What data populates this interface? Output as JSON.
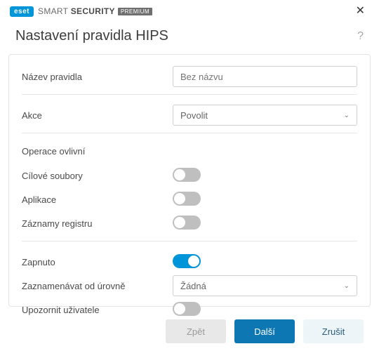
{
  "brand": {
    "badge": "eset",
    "name_light": "SMART",
    "name_bold": "SECURITY",
    "edition": "PREMIUM"
  },
  "header": {
    "title": "Nastavení pravidla HIPS"
  },
  "fields": {
    "rule_name_label": "Název pravidla",
    "rule_name_placeholder": "Bez názvu",
    "action_label": "Akce",
    "action_value": "Povolit",
    "operations_section": "Operace ovlivní",
    "target_files_label": "Cílové soubory",
    "target_files_on": false,
    "applications_label": "Aplikace",
    "applications_on": false,
    "registry_label": "Záznamy registru",
    "registry_on": false,
    "enabled_label": "Zapnuto",
    "enabled_on": true,
    "log_level_label": "Zaznamenávat od úrovně",
    "log_level_value": "Žádná",
    "notify_label": "Upozornit uživatele",
    "notify_on": false
  },
  "footer": {
    "back": "Zpět",
    "next": "Další",
    "cancel": "Zrušit"
  }
}
